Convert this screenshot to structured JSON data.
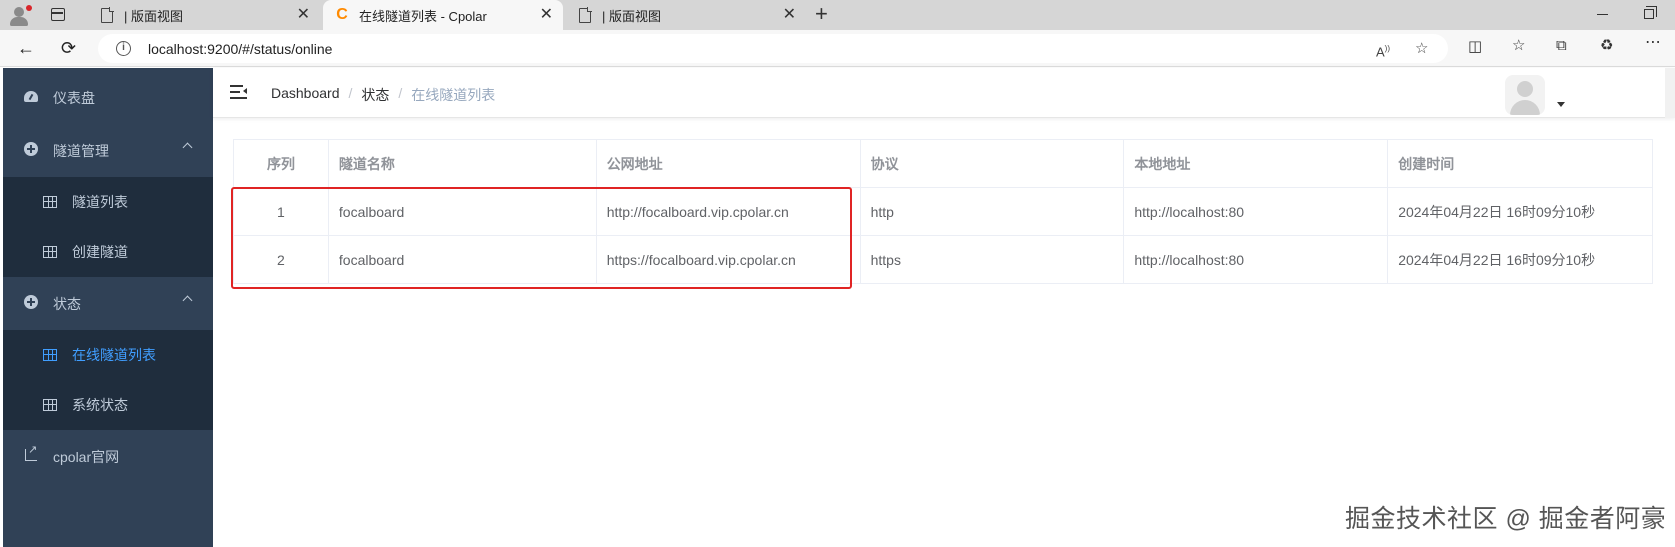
{
  "browser": {
    "tabs": [
      {
        "title": "| 版面视图",
        "icon": "document-icon",
        "active": false
      },
      {
        "title": "在线隧道列表 - Cpolar",
        "icon": "cpolar-icon",
        "active": true
      },
      {
        "title": "| 版面视图",
        "icon": "document-icon",
        "active": false
      }
    ],
    "url": "localhost:9200/#/status/online"
  },
  "sidebar": {
    "items": [
      {
        "label": "仪表盘",
        "icon": "dashboard-icon"
      },
      {
        "label": "隧道管理",
        "icon": "plus-circle-icon",
        "expanded": true,
        "children": [
          {
            "label": "隧道列表",
            "icon": "table-icon"
          },
          {
            "label": "创建隧道",
            "icon": "table-icon"
          }
        ]
      },
      {
        "label": "状态",
        "icon": "plus-circle-icon",
        "expanded": true,
        "children": [
          {
            "label": "在线隧道列表",
            "icon": "table-icon",
            "active": true
          },
          {
            "label": "系统状态",
            "icon": "table-icon"
          }
        ]
      },
      {
        "label": "cpolar官网",
        "icon": "external-link-icon"
      }
    ],
    "active_color": "#409eff",
    "bg_color": "#304156"
  },
  "breadcrumb": [
    "Dashboard",
    "状态",
    "在线隧道列表"
  ],
  "table": {
    "headers": [
      "序列",
      "隧道名称",
      "公网地址",
      "协议",
      "本地地址",
      "创建时间"
    ],
    "rows": [
      [
        "1",
        "focalboard",
        "http://focalboard.vip.cpolar.cn",
        "http",
        "http://localhost:80",
        "2024年04月22日 16时09分10秒"
      ],
      [
        "2",
        "focalboard",
        "https://focalboard.vip.cpolar.cn",
        "https",
        "http://localhost:80",
        "2024年04月22日 16时09分10秒"
      ]
    ]
  },
  "watermark": "掘金技术社区 @ 掘金者阿豪"
}
